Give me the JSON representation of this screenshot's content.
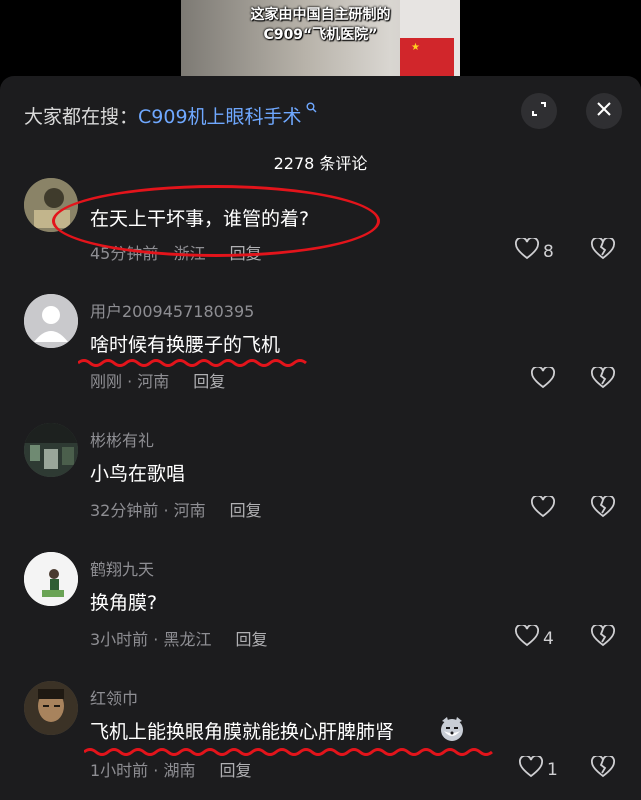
{
  "video": {
    "caption_line1": "这家由中国自主研制的",
    "caption_line2": "C909“飞机医院”"
  },
  "search": {
    "prefix": "大家都在搜：",
    "keyword": "C909机上眼科手术"
  },
  "comment_count": "2278 条评论",
  "comments": [
    {
      "username": "",
      "text": "在天上干坏事，谁管的着?",
      "time": "45分钟前 · 浙江",
      "reply": "回复",
      "likes": "8"
    },
    {
      "username": "用户2009457180395",
      "text": "啥时候有换腰子的飞机",
      "time": "刚刚 · 河南",
      "reply": "回复",
      "likes": ""
    },
    {
      "username": "彬彬有礼",
      "text": "小鸟在歌唱",
      "time": "32分钟前 · 河南",
      "reply": "回复",
      "likes": ""
    },
    {
      "username": "鹤翔九天",
      "text": "换角膜?",
      "time": "3小时前 · 黑龙江",
      "reply": "回复",
      "likes": "4"
    },
    {
      "username": "红领巾",
      "text": "飞机上能换眼角膜就能换心肝脾肺肾",
      "time": "1小时前 · 湖南",
      "reply": "回复",
      "likes": "1"
    }
  ],
  "colors": {
    "sheet_bg": "#1c1c1e",
    "accent_link": "#6fa8ff",
    "annotation_red": "#e3141b"
  },
  "icons": [
    "search-icon",
    "expand-icon",
    "close-icon",
    "heart-icon",
    "broken-heart-icon",
    "wolf-emoji-icon"
  ]
}
